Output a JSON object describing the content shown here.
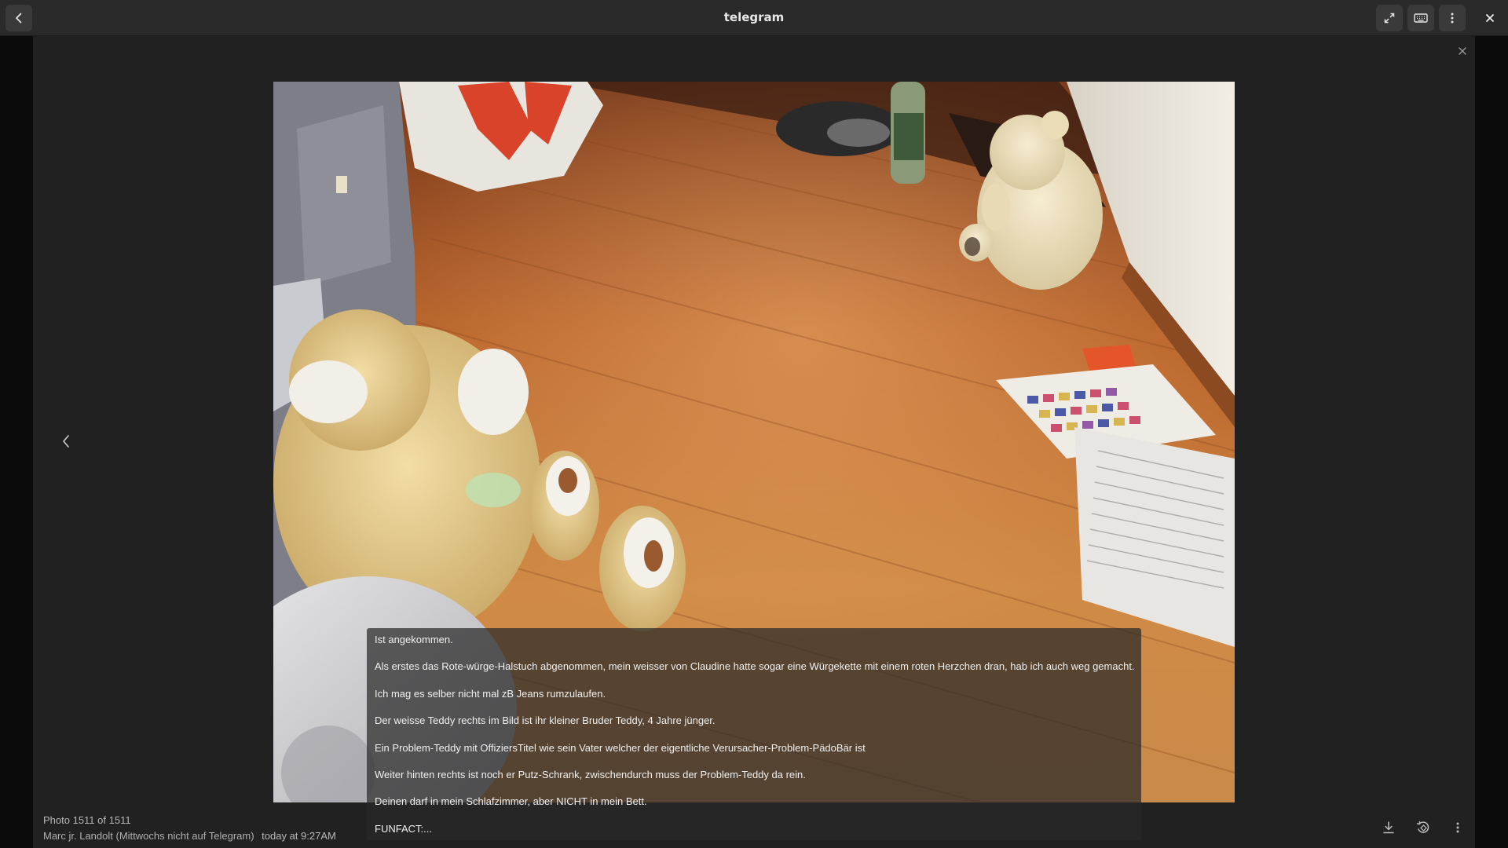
{
  "window": {
    "title": "telegram"
  },
  "titlebar": {
    "back_icon": "chevron-left-icon",
    "expand_icon": "fullscreen-icon",
    "keyboard_icon": "keyboard-icon",
    "menu_icon": "vertical-ellipsis-icon",
    "close_icon": "close-icon"
  },
  "viewer": {
    "close_icon": "close-icon",
    "prev_icon": "chevron-left-icon"
  },
  "caption": {
    "lines": [
      "Ist angekommen.",
      "Als erstes das Rote-würge-Halstuch abgenommen, mein weisser von Claudine hatte sogar eine Würgekette mit einem roten Herzchen dran, hab ich auch weg gemacht.",
      "Ich mag es selber nicht mal zB Jeans rumzulaufen.",
      "Der weisse Teddy rechts im Bild ist ihr kleiner Bruder Teddy, 4 Jahre jünger.",
      "Ein Problem-Teddy mit OffiziersTitel wie sein Vater welcher der eigentliche Verursacher-Problem-PädoBär ist",
      "Weiter hinten rechts ist noch er Putz-Schrank, zwischendurch muss der Problem-Teddy da rein.",
      "Deinen darf in mein Schlafzimmer, aber NICHT in mein Bett.",
      "FUNFACT:..."
    ]
  },
  "info": {
    "counter": "Photo 1511 of 1511",
    "sender": "Marc jr. Landolt (Mittwochs nicht auf Telegram)",
    "time": "today at 9:27AM"
  },
  "actions": {
    "download_icon": "download-icon",
    "rotate_icon": "rotate-icon",
    "more_icon": "vertical-ellipsis-icon"
  }
}
